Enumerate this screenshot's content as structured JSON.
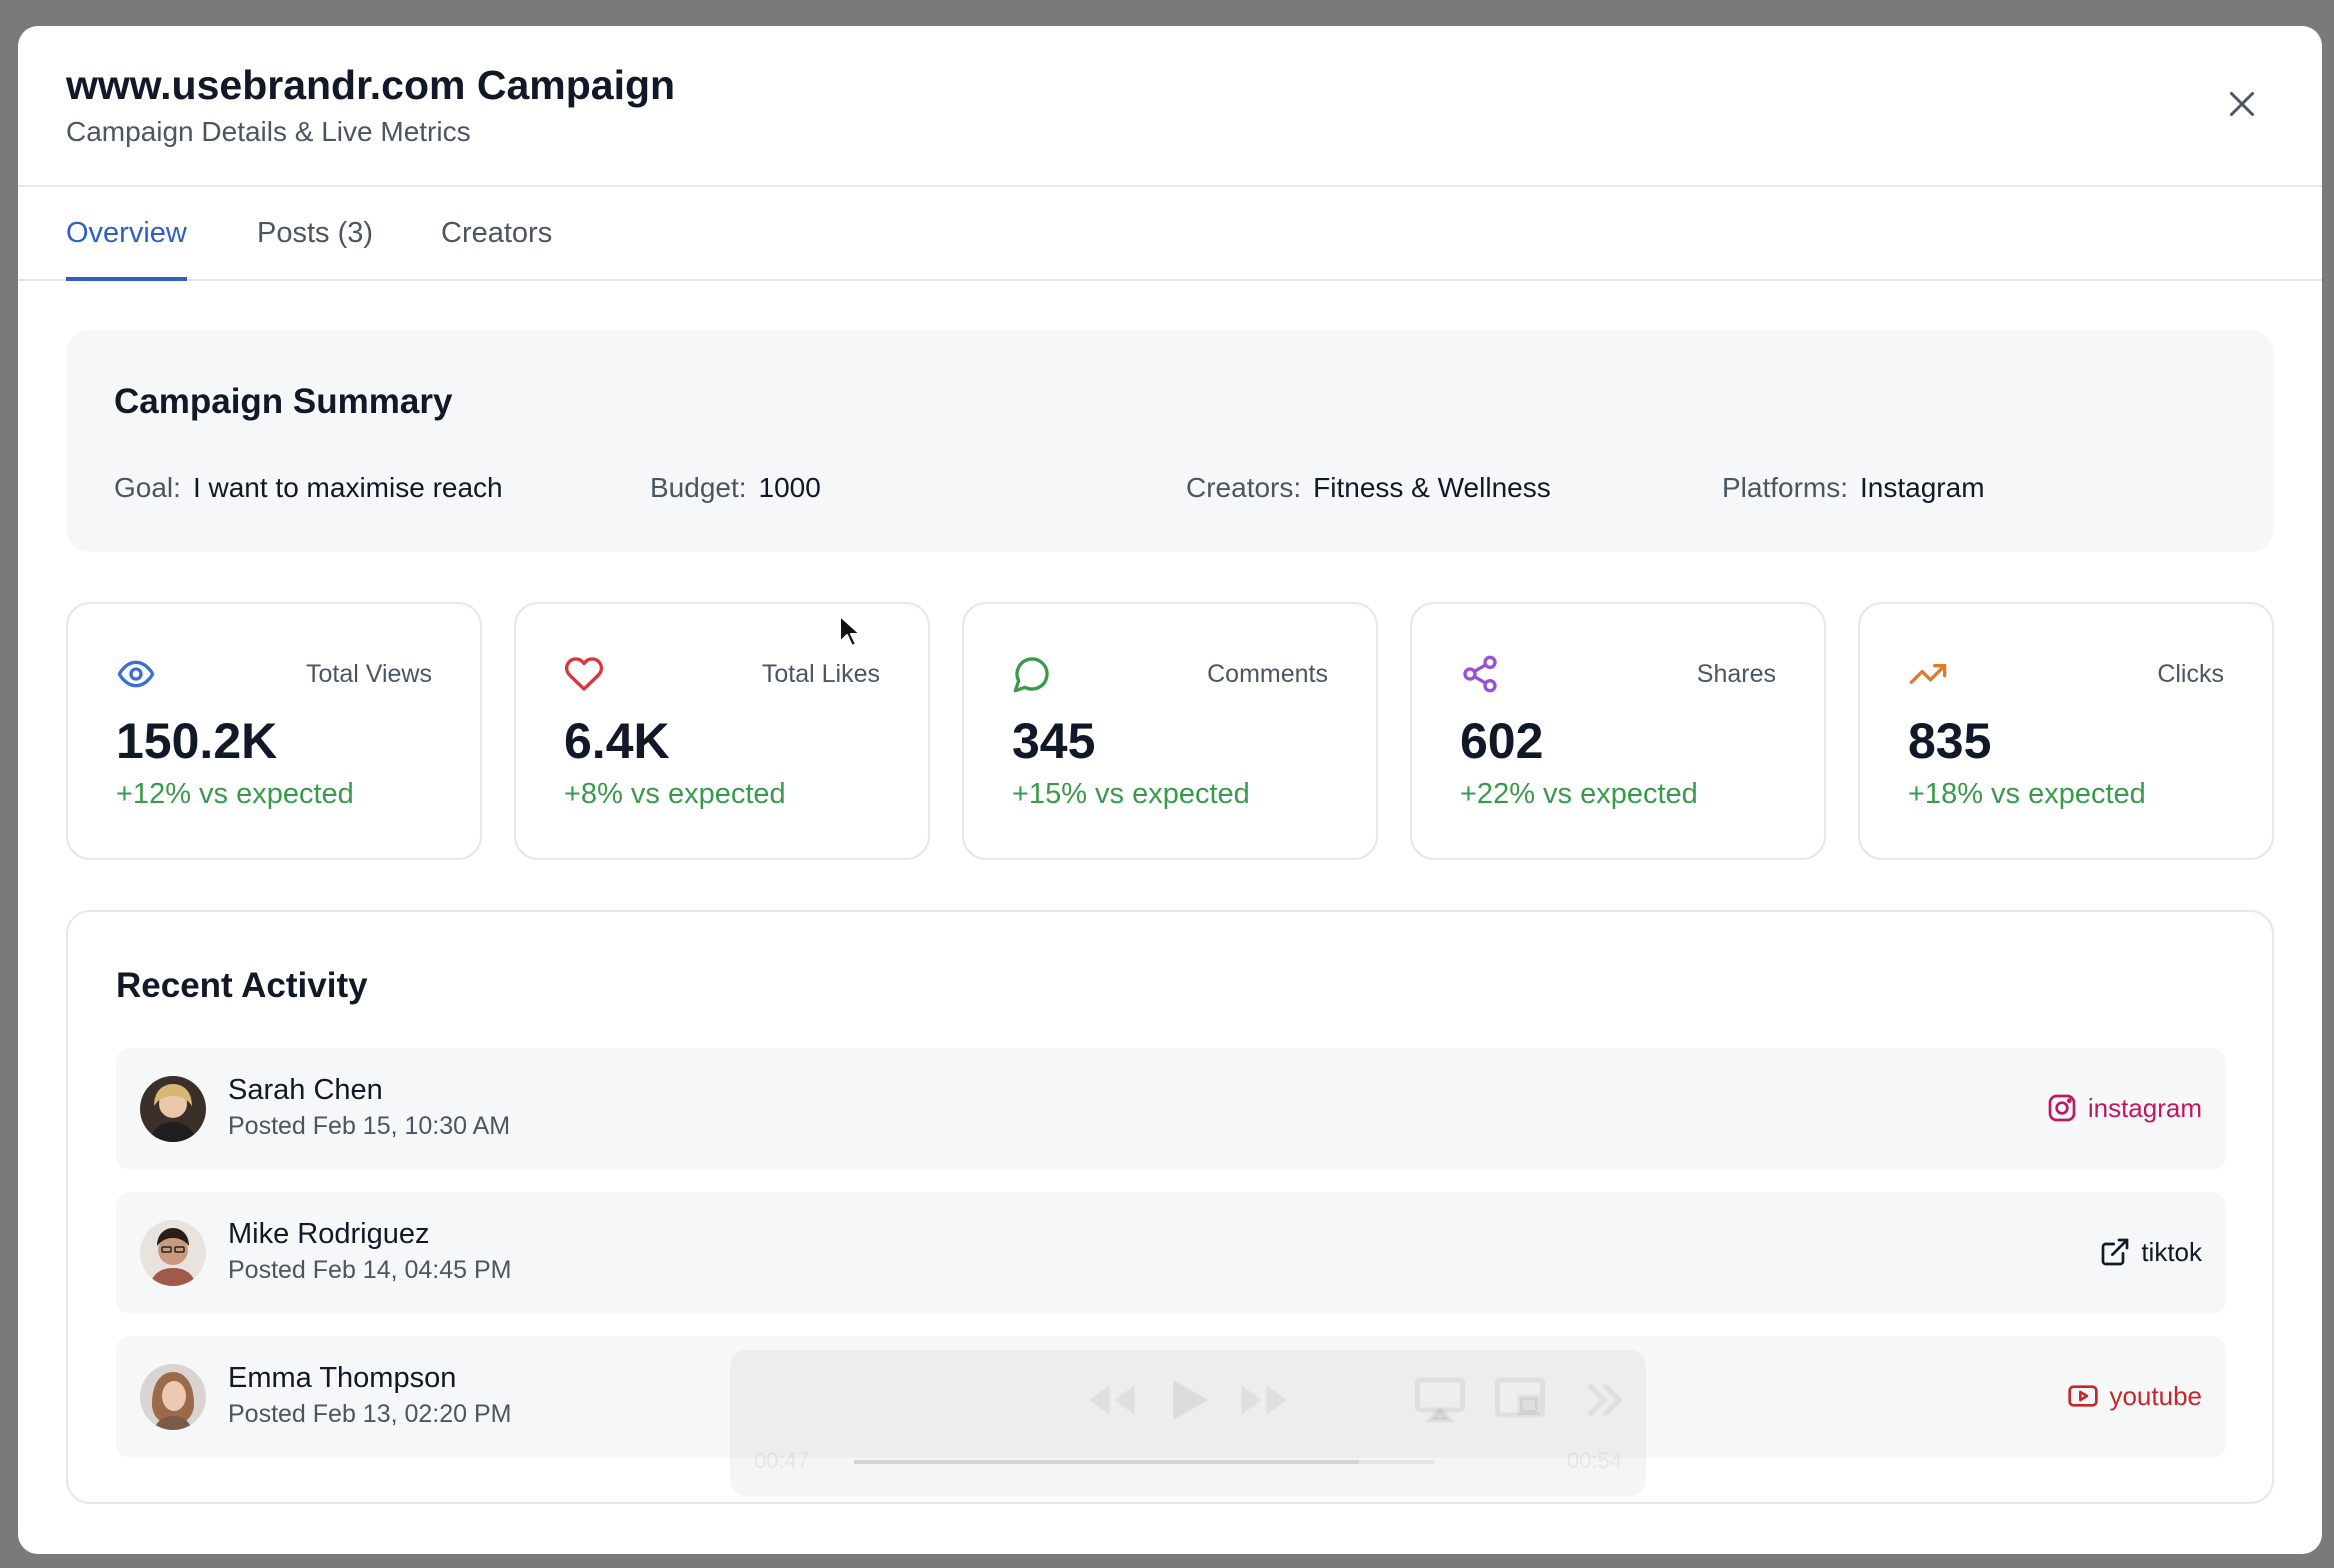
{
  "header": {
    "title": "www.usebrandr.com Campaign",
    "subtitle": "Campaign Details & Live Metrics"
  },
  "tabs": [
    {
      "label": "Overview",
      "active": true
    },
    {
      "label": "Posts (3)",
      "active": false
    },
    {
      "label": "Creators",
      "active": false
    }
  ],
  "summary": {
    "title": "Campaign Summary",
    "goal_label": "Goal:",
    "goal": "I want to maximise reach",
    "budget_label": "Budget:",
    "budget": "1000",
    "creators_label": "Creators:",
    "creators": "Fitness & Wellness",
    "platforms_label": "Platforms:",
    "platforms": "Instagram"
  },
  "metrics": [
    {
      "label": "Total Views",
      "value": "150.2K",
      "delta": "+12% vs expected",
      "icon": "eye-icon",
      "color": "#3b6fd6"
    },
    {
      "label": "Total Likes",
      "value": "6.4K",
      "delta": "+8% vs expected",
      "icon": "heart-icon",
      "color": "#d9363e"
    },
    {
      "label": "Comments",
      "value": "345",
      "delta": "+15% vs expected",
      "icon": "message-circle-icon",
      "color": "#3a9a4c"
    },
    {
      "label": "Shares",
      "value": "602",
      "delta": "+22% vs expected",
      "icon": "share-icon",
      "color": "#9b4fd6"
    },
    {
      "label": "Clicks",
      "value": "835",
      "delta": "+18% vs expected",
      "icon": "trending-up-icon",
      "color": "#e07a2a"
    }
  ],
  "activity": {
    "title": "Recent Activity",
    "items": [
      {
        "name": "Sarah Chen",
        "posted": "Posted Feb 15, 10:30 AM",
        "platform": "instagram",
        "platform_icon": "instagram-icon",
        "color": "#c2185b"
      },
      {
        "name": "Mike Rodriguez",
        "posted": "Posted Feb 14, 04:45 PM",
        "platform": "tiktok",
        "platform_icon": "external-link-icon",
        "color": "#111827"
      },
      {
        "name": "Emma Thompson",
        "posted": "Posted Feb 13, 02:20 PM",
        "platform": "youtube",
        "platform_icon": "youtube-icon",
        "color": "#c62828"
      }
    ]
  },
  "video_player": {
    "elapsed": "00:47",
    "duration": "00:54",
    "progress": 0.87
  }
}
